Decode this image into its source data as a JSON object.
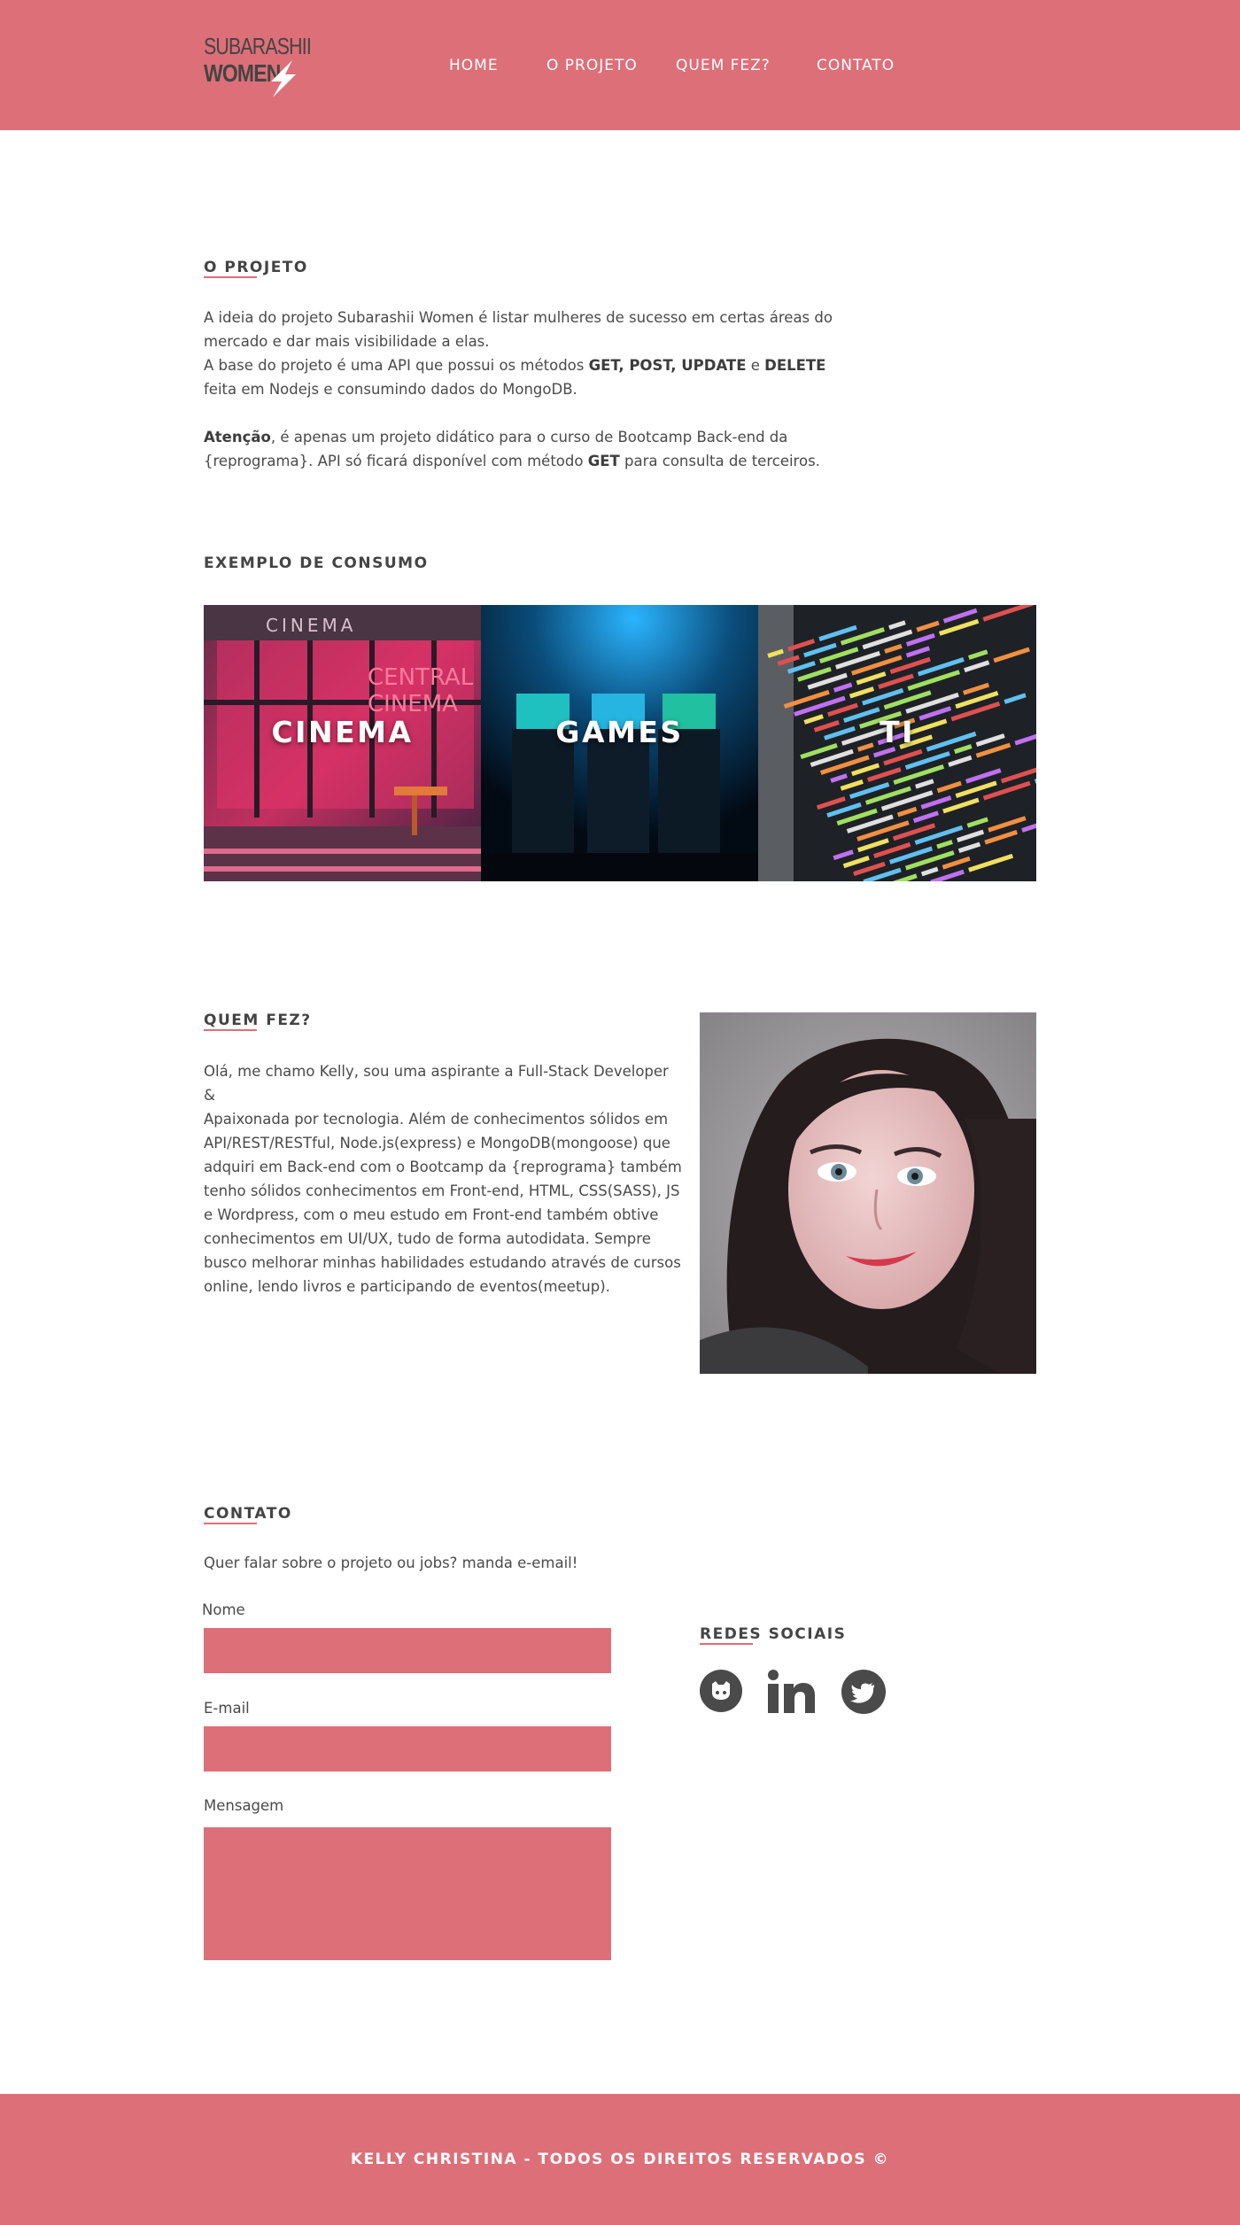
{
  "brand": {
    "logo_top": "SUBARASHII",
    "logo_bottom": "WOMEN",
    "accent_color": "#dd6f78",
    "text_color": "#444444"
  },
  "nav": {
    "items": [
      {
        "label": "HOME"
      },
      {
        "label": "O PROJETO"
      },
      {
        "label": "QUEM FEZ?"
      },
      {
        "label": "CONTATO"
      }
    ]
  },
  "projeto": {
    "title": "O PROJETO",
    "p1_line1": "A ideia do projeto Subarashii Women é listar mulheres de sucesso em certas áreas do",
    "p1_line2": "mercado e dar mais visibilidade a elas.",
    "p2_line1_a": "A base do projeto é uma API que possui os métodos ",
    "p2_line1_b": "GET, POST, UPDATE",
    "p2_line1_c": " e ",
    "p2_line1_d": "DELETE",
    "p2_line2": "feita em Nodejs e consumindo dados do MongoDB.",
    "p3_line1_a": "Atenção",
    "p3_line1_b": ", é apenas um projeto didático para o curso de Bootcamp Back-end da",
    "p3_line2_a": "{reprograma}. API só ficará disponível com método ",
    "p3_line2_b": "GET",
    "p3_line2_c": " para consulta de terceiros."
  },
  "exemplo": {
    "title": "EXEMPLO DE CONSUMO",
    "tiles": [
      {
        "label": "CINEMA",
        "sign_text": "CINEMA",
        "neon_text_1": "CENTRAL",
        "neon_text_2": "CINEMA"
      },
      {
        "label": "GAMES"
      },
      {
        "label": "TI"
      }
    ]
  },
  "quem": {
    "title": "QUEM FEZ?",
    "lines": [
      "Olá, me chamo Kelly, sou uma aspirante a Full-Stack Developer &",
      "Apaixonada por tecnologia. Além de conhecimentos sólidos em",
      "API/REST/RESTful, Node.js(express) e MongoDB(mongoose) que",
      "adquiri em Back-end com o Bootcamp da {reprograma} também",
      "tenho sólidos conhecimentos em Front-end, HTML, CSS(SASS), JS",
      "e Wordpress, com o meu estudo em Front-end também obtive",
      "conhecimentos em UI/UX, tudo de forma autodidata. Sempre",
      "busco melhorar minhas habilidades estudando através de cursos",
      "online, lendo livros e participando de eventos(meetup)."
    ]
  },
  "contato": {
    "title": "CONTATO",
    "intro": "Quer falar sobre o projeto ou jobs? manda e-email!",
    "name_label": "Nome",
    "email_label": "E-mail",
    "message_label": "Mensagem",
    "social_title_a": "REDES",
    "social_title_b": " SOCIAIS",
    "social_icons": [
      "github-icon",
      "linkedin-icon",
      "twitter-icon"
    ]
  },
  "footer": {
    "text": "KELLY CHRISTINA - TODOS OS DIREITOS RESERVADOS ©"
  }
}
